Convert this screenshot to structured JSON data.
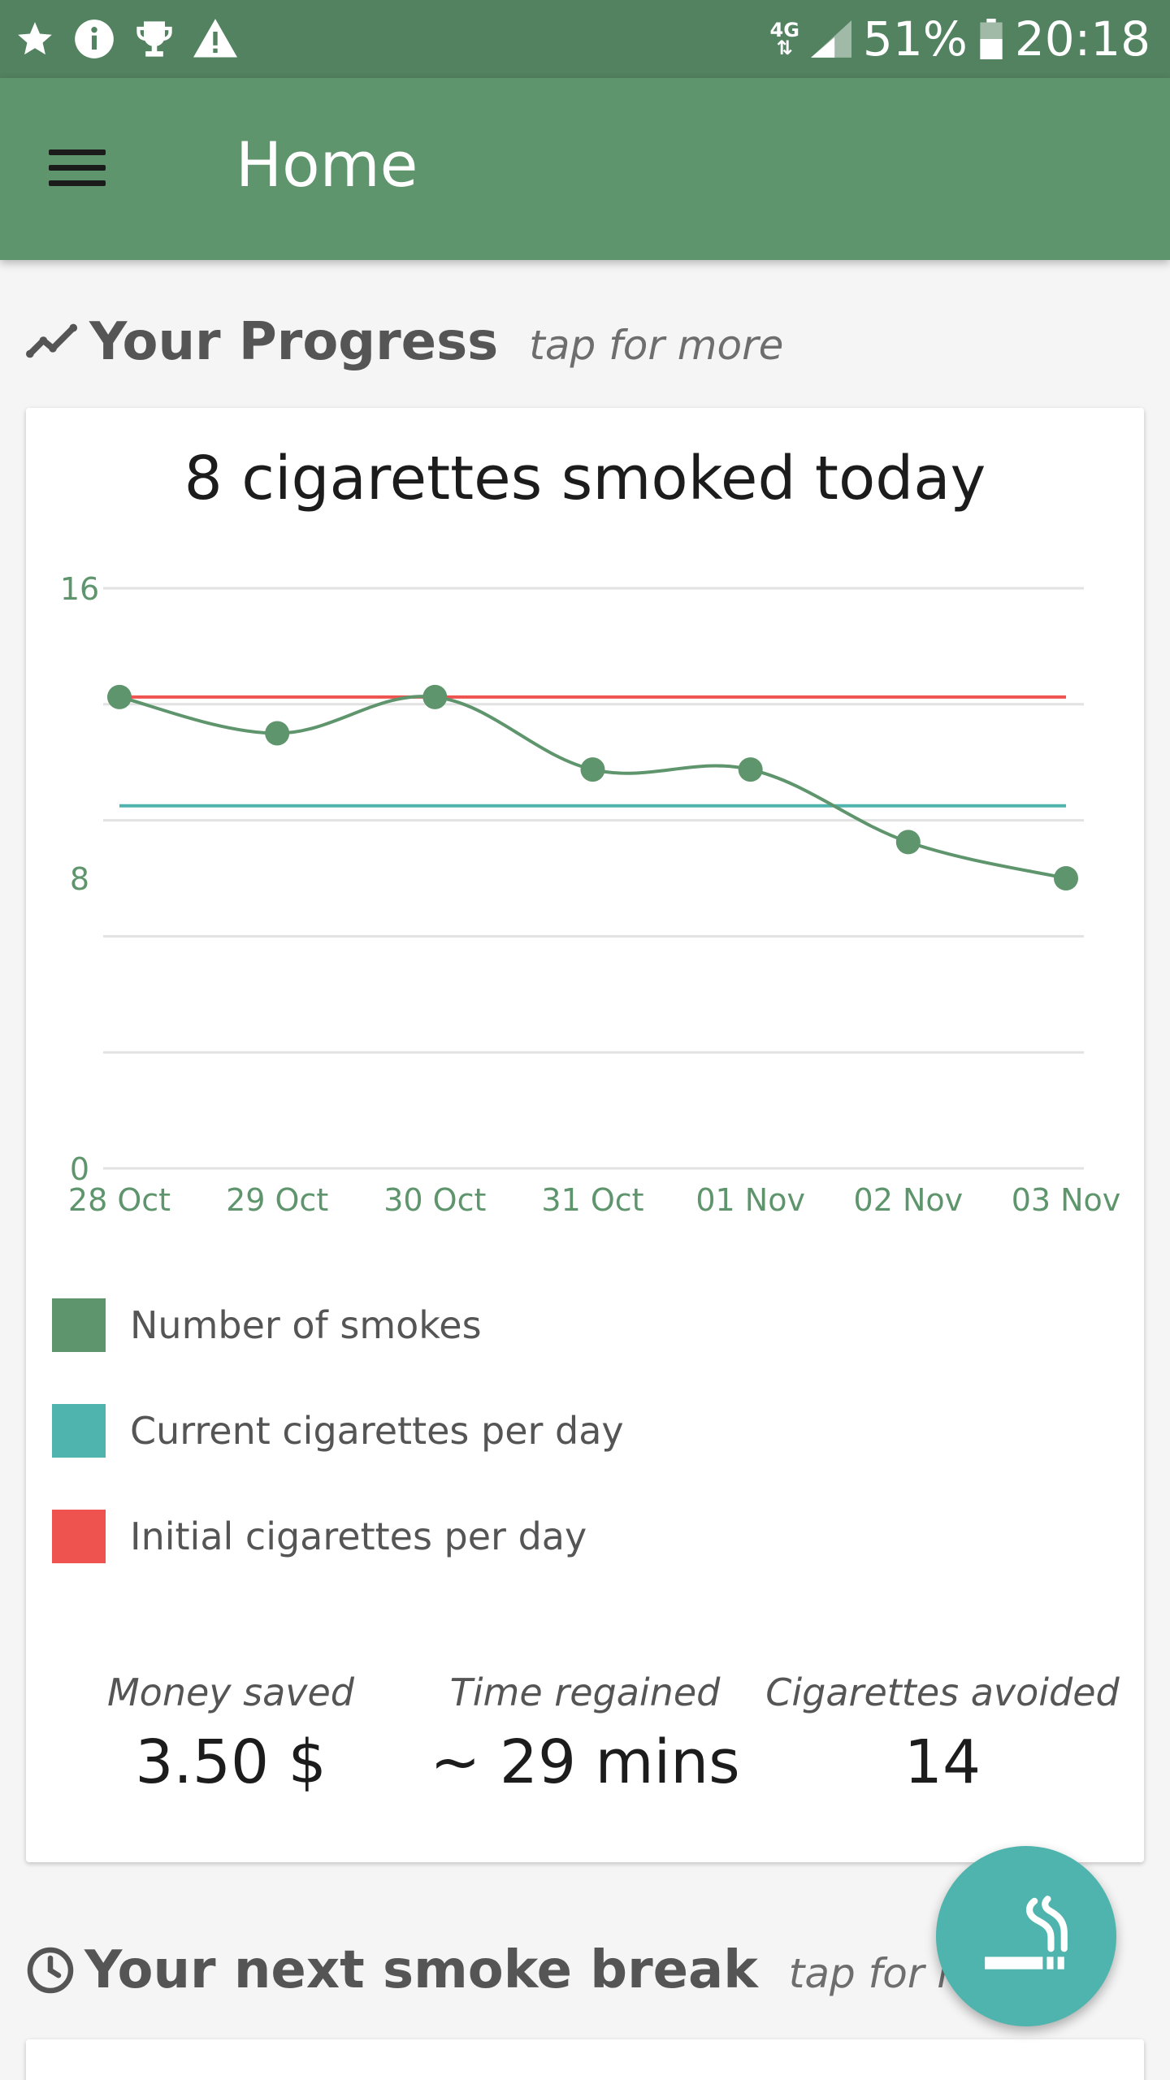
{
  "status_bar": {
    "network": "4G",
    "battery": "51%",
    "time": "20:18",
    "left_icons": [
      "star-icon",
      "info-icon",
      "trophy-icon",
      "warning-icon"
    ]
  },
  "app_bar": {
    "title": "Home",
    "menu_icon": "menu-icon"
  },
  "progress_section": {
    "title": "Your Progress",
    "hint": "tap for more",
    "icon": "trending-icon"
  },
  "progress_card": {
    "title": "8 cigarettes smoked today",
    "legend": [
      {
        "label": "Number of smokes",
        "color": "#5e956c"
      },
      {
        "label": "Current cigarettes per day",
        "color": "#4fb4ad"
      },
      {
        "label": "Initial cigarettes per day",
        "color": "#ef5350"
      }
    ],
    "stats": [
      {
        "label": "Money saved",
        "value": "3.50 $"
      },
      {
        "label": "Time regained",
        "value": "~ 29 mins"
      },
      {
        "label": "Cigarettes avoided",
        "value": "14"
      }
    ]
  },
  "chart_data": {
    "type": "line",
    "categories": [
      "28 Oct",
      "29 Oct",
      "30 Oct",
      "31 Oct",
      "01 Nov",
      "02 Nov",
      "03 Nov"
    ],
    "y_ticks": [
      16,
      8,
      0
    ],
    "ylim": [
      0,
      16
    ],
    "grid": true,
    "series": [
      {
        "name": "Number of smokes",
        "values": [
          13,
          12,
          13,
          11,
          11,
          9,
          8
        ],
        "color": "#5e956c",
        "markers": true
      },
      {
        "name": "Current cigarettes per day",
        "values": [
          10,
          10,
          10,
          10,
          10,
          10,
          10
        ],
        "color": "#4fb4ad",
        "markers": false
      },
      {
        "name": "Initial cigarettes per day",
        "values": [
          13,
          13,
          13,
          13,
          13,
          13,
          13
        ],
        "color": "#ef5350",
        "markers": false
      }
    ]
  },
  "smoke_break_section": {
    "title": "Your next smoke break",
    "hint": "tap for more",
    "icon": "clock-icon"
  },
  "fab": {
    "icon": "smoking-icon"
  }
}
